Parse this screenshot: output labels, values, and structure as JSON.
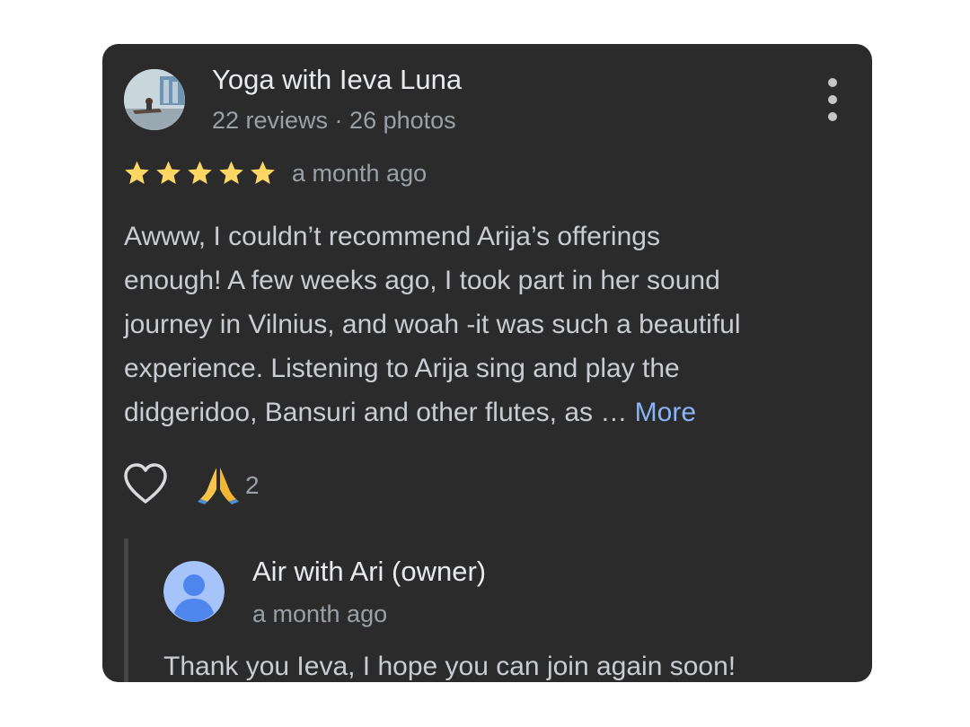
{
  "review": {
    "reviewer_name": "Yoga with Ieva Luna",
    "reviewer_meta": "22 reviews · 26 photos",
    "avatar_icon": "profile-photo",
    "menu_icon": "more-vert-icon",
    "rating": 5,
    "rating_max": 5,
    "star_color": "#fdd663",
    "time": "a month ago",
    "text_lines": [
      "Awww, I couldn’t recommend Arija’s offerings",
      "enough! A few weeks ago, I took part in her sound",
      "journey in Vilnius, and woah -it was such a beautiful",
      "experience. Listening to Arija sing and play the",
      "didgeridoo, Bansuri and other flutes, as … "
    ],
    "more_label": "More",
    "like_icon": "heart-outline-icon",
    "reaction_emoji": "🙏",
    "reaction_count": "2"
  },
  "owner_response": {
    "name": "Air with Ari (owner)",
    "time": "a month ago",
    "text": "Thank you Ieva, I hope you can join again soon!",
    "avatar_icon": "default-person-icon"
  },
  "colors": {
    "card_background": "#2b2b2b",
    "link": "#8ab4f8",
    "avatar_blue": "#5e97f6"
  }
}
